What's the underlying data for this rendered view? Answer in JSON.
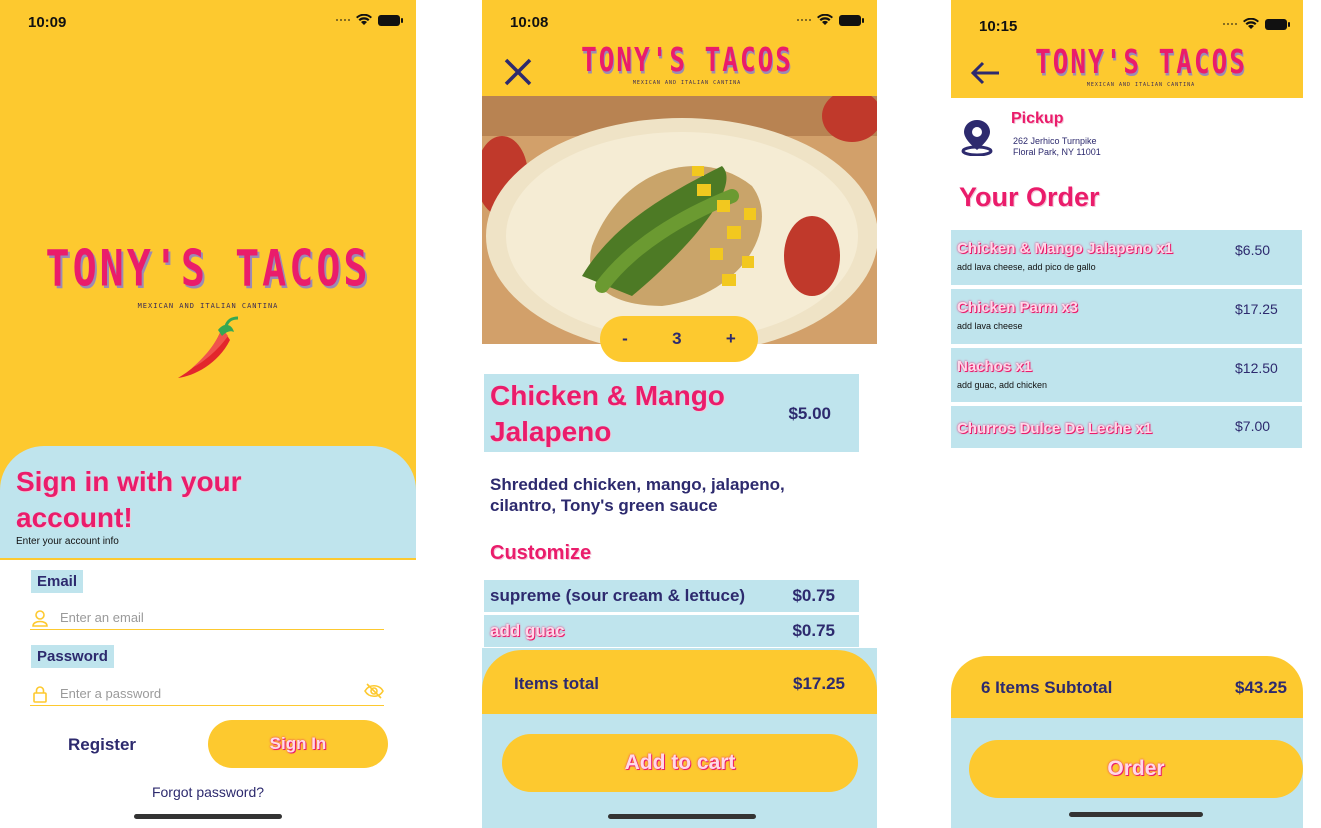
{
  "colors": {
    "yellow": "#fdc92f",
    "light_blue": "#bfe4ed",
    "pink": "#ea1c6b",
    "navy": "#2d2a6e"
  },
  "brand": {
    "name": "TONY'S TACOS",
    "tagline": "MEXICAN AND ITALIAN CANTINA"
  },
  "signin_screen": {
    "time": "10:09",
    "headline": "Sign in with your account!",
    "subhead": "Enter your account info",
    "email_label": "Email",
    "email_placeholder": "Enter an email",
    "password_label": "Password",
    "password_placeholder": "Enter a password",
    "register_label": "Register",
    "signin_label": "Sign In",
    "forgot_label": "Forgot password?",
    "icons": [
      "user-icon",
      "lock-icon",
      "eye-off-icon",
      "chili-pepper-icon"
    ]
  },
  "item_screen": {
    "time": "10:08",
    "quantity": {
      "minus": "-",
      "value": "3",
      "plus": "+"
    },
    "item_name": "Chicken & Mango Jalapeno",
    "item_price": "$5.00",
    "description": "Shredded chicken, mango, jalapeno, cilantro, Tony's green sauce",
    "customize_heading": "Customize",
    "options": [
      {
        "label": "supreme (sour cream & lettuce)",
        "price": "$0.75",
        "selected": false
      },
      {
        "label": "add guac",
        "price": "$0.75",
        "selected": true
      }
    ],
    "total_label": "Items total",
    "total_value": "$17.25",
    "add_to_cart_label": "Add to cart",
    "icons": [
      "close-icon",
      "taco-photo"
    ]
  },
  "order_screen": {
    "time": "10:15",
    "pickup_label": "Pickup",
    "address_line1": "262 Jerhico Turnpike",
    "address_line2": "Floral Park, NY 11001",
    "your_order_heading": "Your Order",
    "orders": [
      {
        "name": "Chicken & Mango Jalapeno x1",
        "price": "$6.50",
        "mods": "add lava cheese, add pico de gallo"
      },
      {
        "name": "Chicken Parm x3",
        "price": "$17.25",
        "mods": "add lava cheese"
      },
      {
        "name": "Nachos x1",
        "price": "$12.50",
        "mods": "add guac, add chicken"
      },
      {
        "name": "Churros Dulce De Leche x1",
        "price": "$7.00",
        "mods": ""
      }
    ],
    "subtotal_label": "6 Items Subtotal",
    "subtotal_value": "$43.25",
    "order_label": "Order",
    "icons": [
      "back-arrow-icon",
      "location-pin-icon"
    ]
  }
}
